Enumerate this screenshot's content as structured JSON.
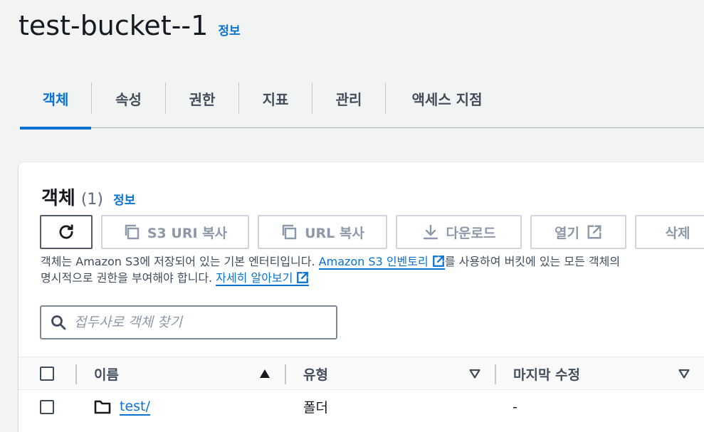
{
  "page": {
    "title": "test-bucket--1",
    "info_label": "정보"
  },
  "tabs": [
    {
      "label": "객체",
      "active": true
    },
    {
      "label": "속성",
      "active": false
    },
    {
      "label": "권한",
      "active": false
    },
    {
      "label": "지표",
      "active": false
    },
    {
      "label": "관리",
      "active": false
    },
    {
      "label": "액세스 지점",
      "active": false
    }
  ],
  "objects_panel": {
    "title": "객체",
    "count": "(1)",
    "info_label": "정보",
    "buttons": {
      "refresh": {
        "icon": "refresh-icon"
      },
      "copy_s3_uri": {
        "label": "S3 URI 복사",
        "icon": "copy-icon"
      },
      "copy_url": {
        "label": "URL 복사",
        "icon": "copy-icon"
      },
      "download": {
        "label": "다운로드",
        "icon": "download-icon"
      },
      "open": {
        "label": "열기",
        "icon": "external-link-icon"
      },
      "delete": {
        "label": "삭제"
      }
    },
    "description": {
      "part1": "객체는 Amazon S3에 저장되어 있는 기본 엔터티입니다. ",
      "link1": "Amazon S3 인벤토리",
      "part2": "를 사용하여 버킷에 있는 모든 객체의",
      "part3": "명시적으로 권한을 부여해야 합니다. ",
      "link2": "자세히 알아보기"
    },
    "search": {
      "placeholder": "접두사로 객체 찾기",
      "value": ""
    },
    "table": {
      "columns": {
        "name": "이름",
        "type": "유형",
        "last_modified": "마지막 수정"
      },
      "rows": [
        {
          "name": "test/",
          "type": "폴더",
          "last_modified": "-",
          "icon": "folder-icon"
        }
      ]
    }
  },
  "colors": {
    "accent": "#0972d3",
    "text": "#16191f",
    "disabled": "#8d99a8",
    "background": "#f2f3f3"
  }
}
